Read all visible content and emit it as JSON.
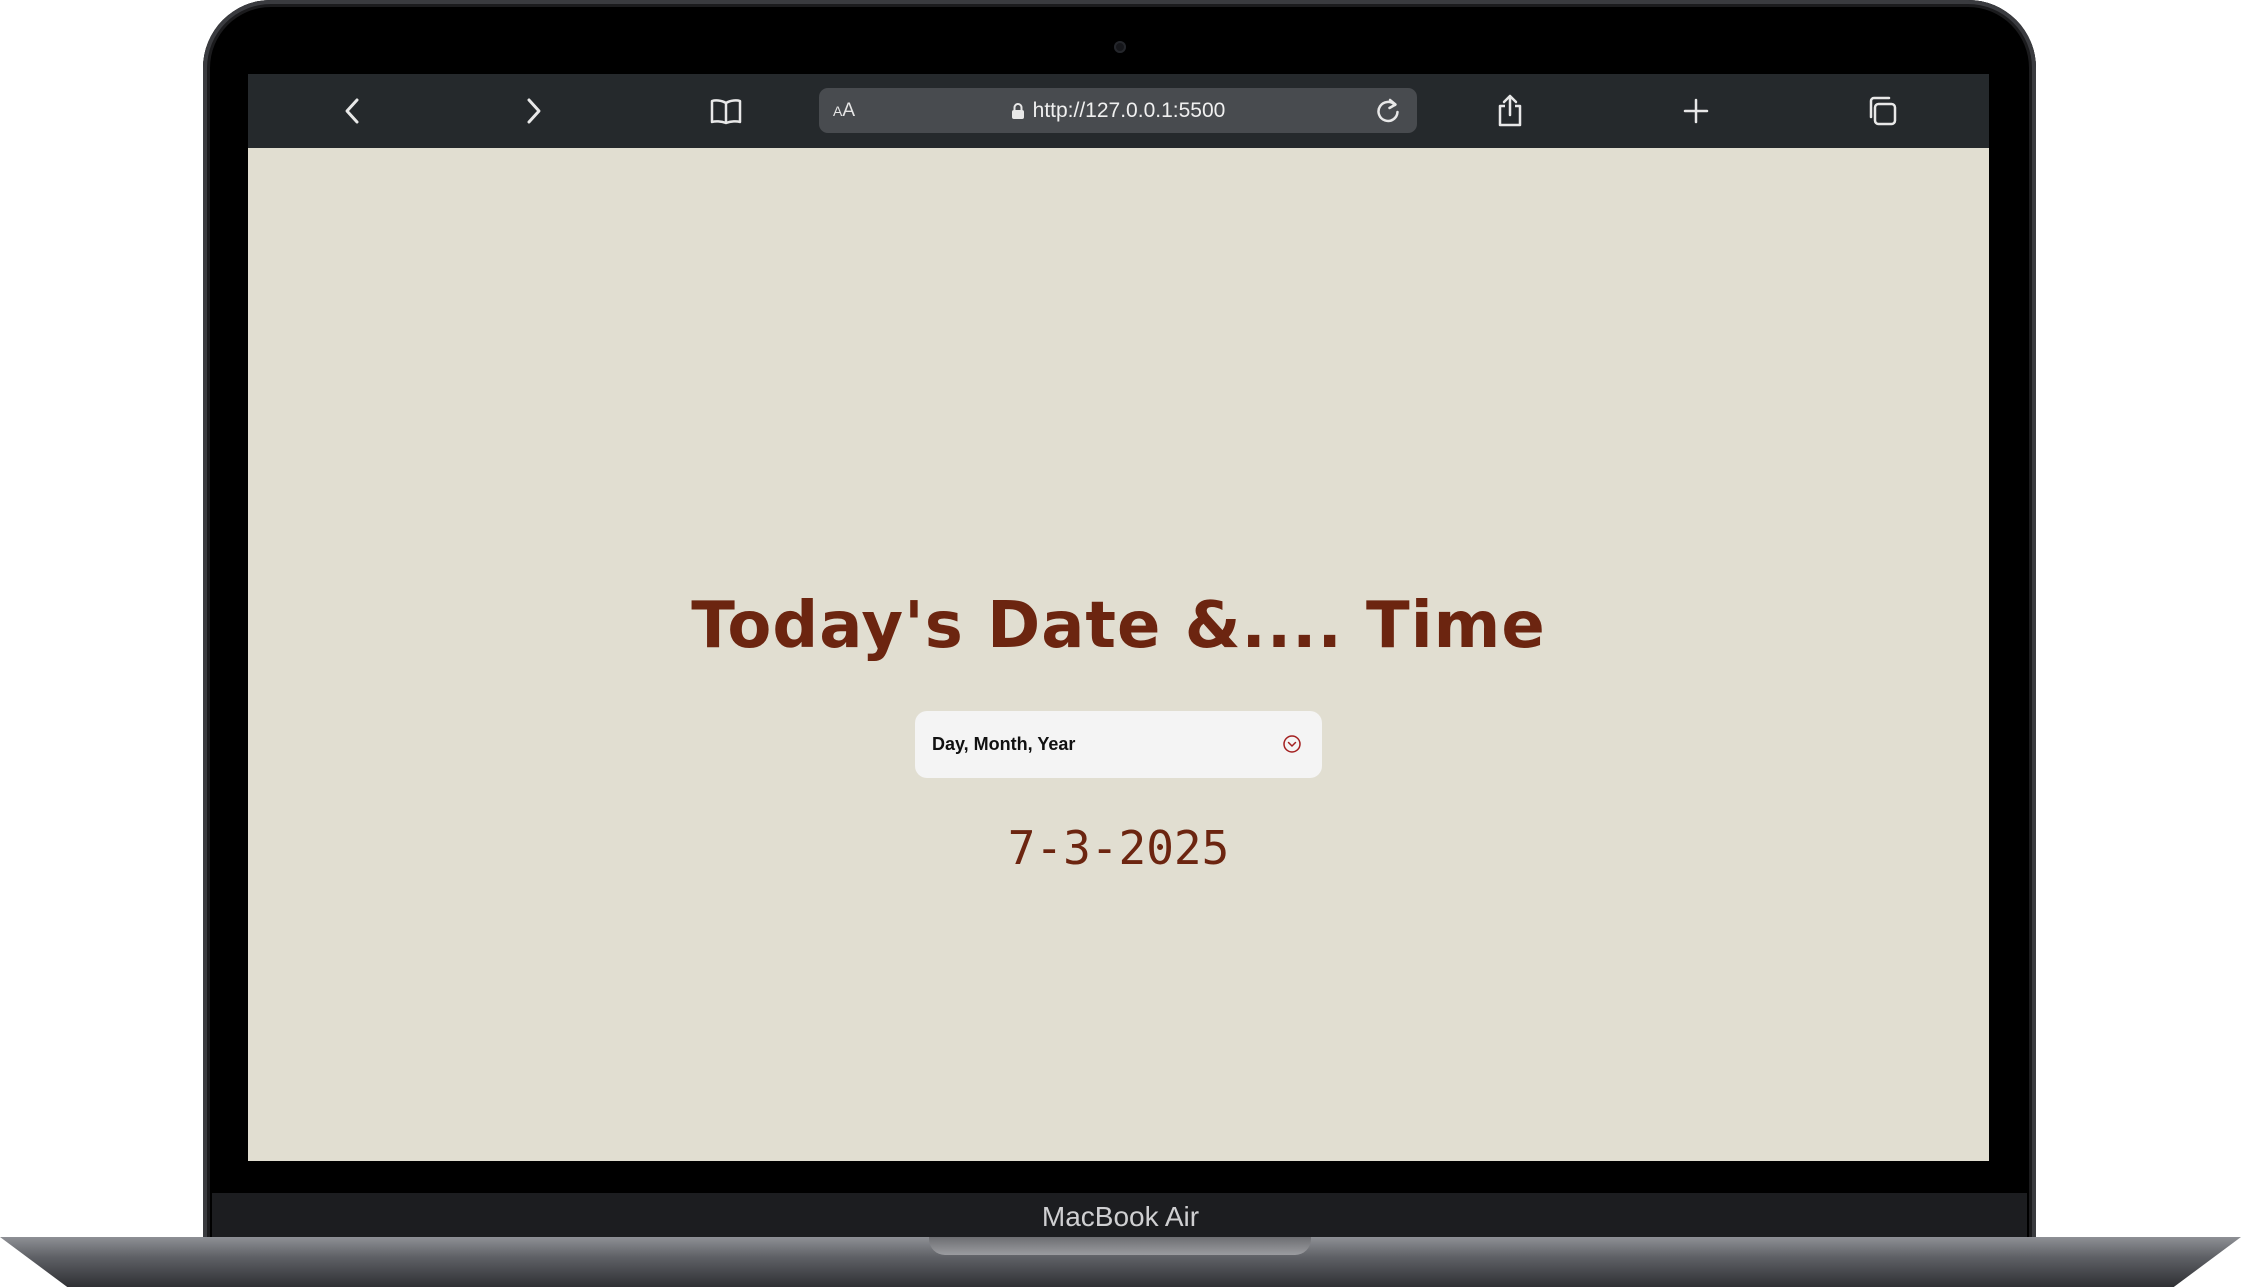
{
  "browser": {
    "reader_button": {
      "small": "A",
      "large": "A"
    },
    "url": "http://127.0.0.1:5500"
  },
  "page": {
    "title": "Today's Date &.... Time",
    "format_select": {
      "selected": "Day, Month, Year"
    },
    "date_value": "7-3-2025"
  },
  "device": {
    "label": "MacBook Air"
  },
  "colors": {
    "page_background": "#e1ded1",
    "accent": "#6c2510",
    "toolbar": "#25292c"
  },
  "icons": [
    "back-arrow-icon",
    "forward-arrow-icon",
    "bookmarks-icon",
    "lock-icon",
    "reload-icon",
    "share-icon",
    "new-tab-icon",
    "tabs-overview-icon",
    "chevron-down-circle-icon"
  ]
}
